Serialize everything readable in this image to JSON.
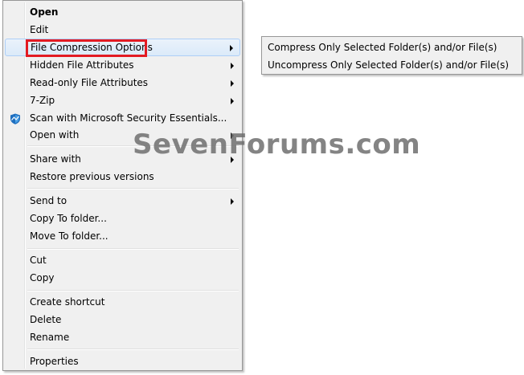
{
  "context_menu": {
    "items": [
      {
        "label": "Open"
      },
      {
        "label": "Edit"
      },
      {
        "label": "File Compression Options"
      },
      {
        "label": "Hidden File Attributes"
      },
      {
        "label": "Read-only File Attributes"
      },
      {
        "label": "7-Zip"
      },
      {
        "label": "Scan with Microsoft Security Essentials..."
      },
      {
        "label": "Open with"
      },
      {
        "label": "Share with"
      },
      {
        "label": "Restore previous versions"
      },
      {
        "label": "Send to"
      },
      {
        "label": "Copy To folder..."
      },
      {
        "label": "Move To folder..."
      },
      {
        "label": "Cut"
      },
      {
        "label": "Copy"
      },
      {
        "label": "Create shortcut"
      },
      {
        "label": "Delete"
      },
      {
        "label": "Rename"
      },
      {
        "label": "Properties"
      }
    ]
  },
  "submenu": {
    "items": [
      {
        "label": "Compress Only Selected Folder(s) and/or File(s)"
      },
      {
        "label": "Uncompress Only Selected Folder(s) and/or File(s)"
      }
    ]
  },
  "watermark": {
    "text": "SevenForums.com"
  },
  "colors": {
    "highlight_border": "#e31b23",
    "menu_bg": "#f0f0f0",
    "hover_border": "#aecff7"
  },
  "icons": {
    "security_essentials": "shield-icon",
    "submenu_arrow": "chevron-right-icon"
  }
}
